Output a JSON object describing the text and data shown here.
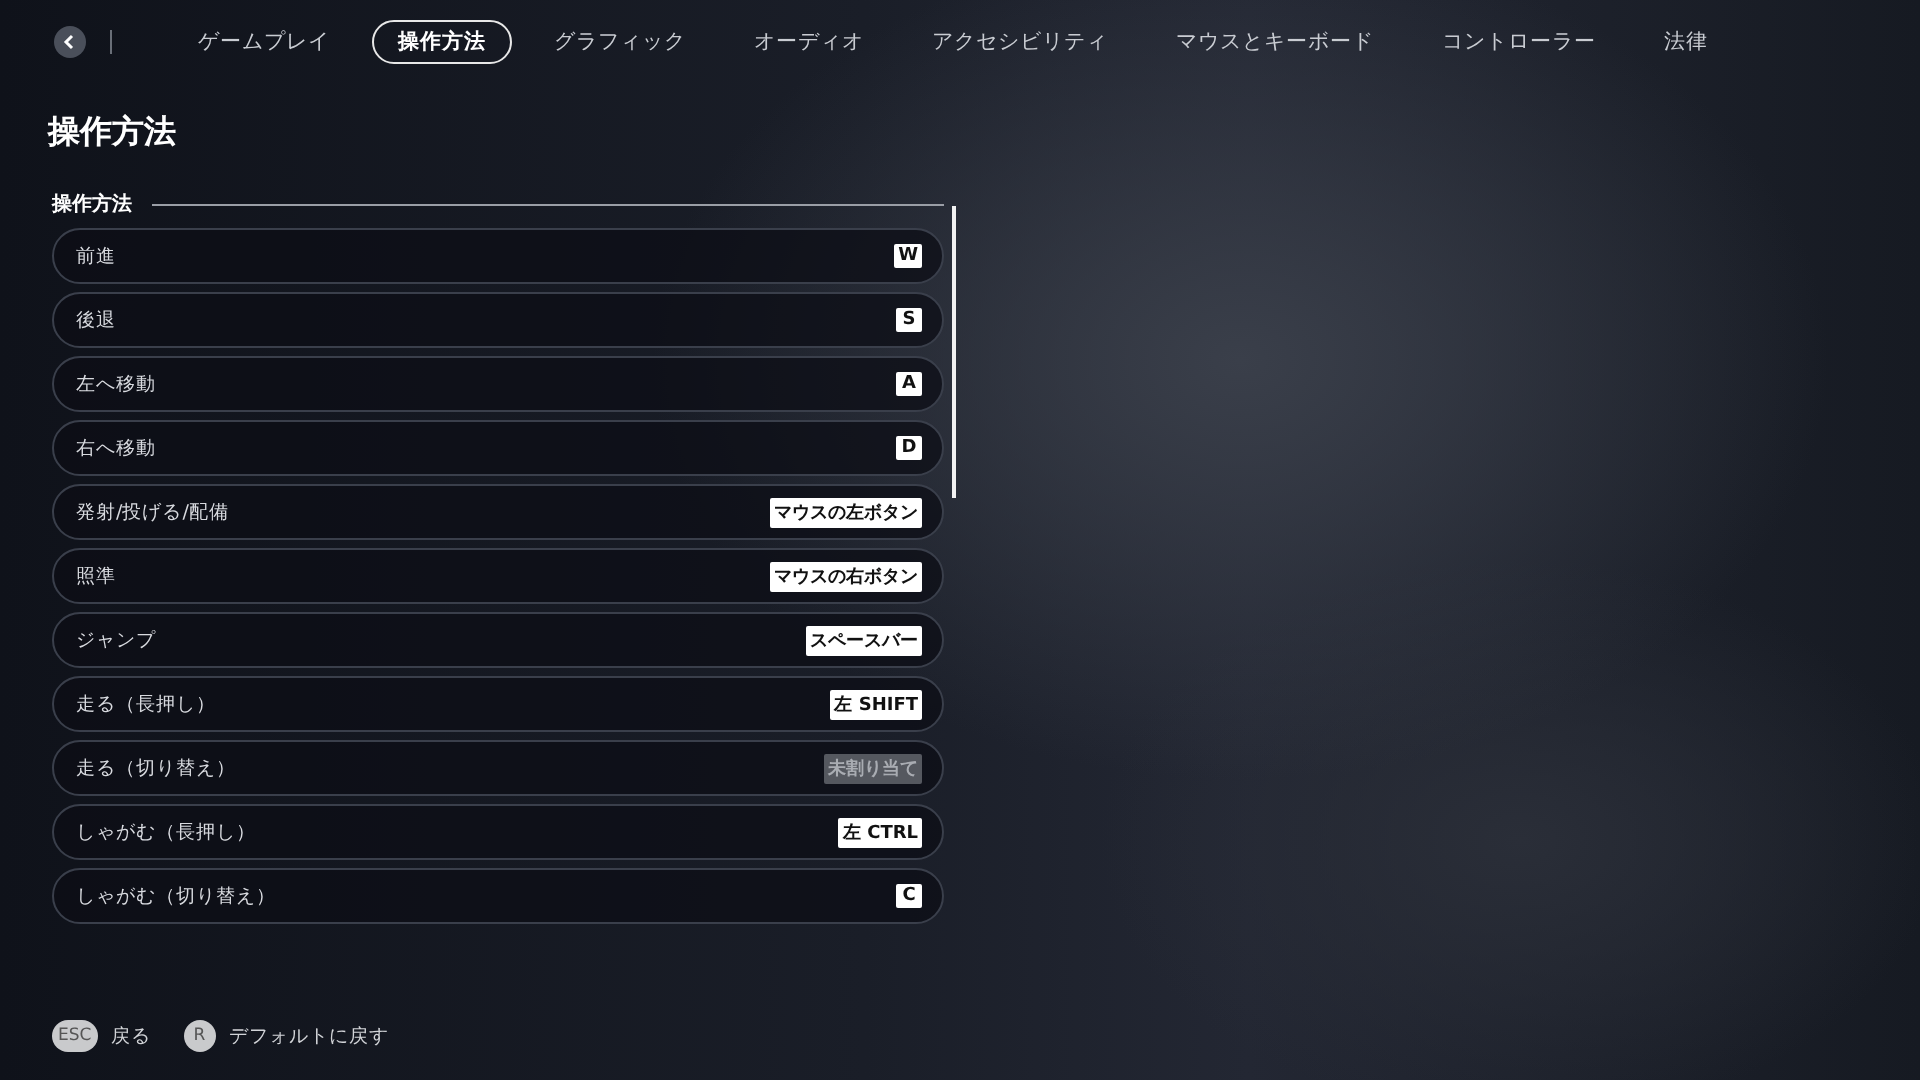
{
  "tabs": [
    {
      "label": "ゲームプレイ",
      "selected": false
    },
    {
      "label": "操作方法",
      "selected": true
    },
    {
      "label": "グラフィック",
      "selected": false
    },
    {
      "label": "オーディオ",
      "selected": false
    },
    {
      "label": "アクセシビリティ",
      "selected": false
    },
    {
      "label": "マウスとキーボード",
      "selected": false
    },
    {
      "label": "コントローラー",
      "selected": false
    },
    {
      "label": "法律",
      "selected": false
    }
  ],
  "page_title": "操作方法",
  "section": {
    "title": "操作方法",
    "bindings": [
      {
        "action": "前進",
        "key": "W",
        "assigned": true
      },
      {
        "action": "後退",
        "key": "S",
        "assigned": true
      },
      {
        "action": "左へ移動",
        "key": "A",
        "assigned": true
      },
      {
        "action": "右へ移動",
        "key": "D",
        "assigned": true
      },
      {
        "action": "発射/投げる/配備",
        "key": "マウスの左ボタン",
        "assigned": true
      },
      {
        "action": "照準",
        "key": "マウスの右ボタン",
        "assigned": true
      },
      {
        "action": "ジャンプ",
        "key": "スペースバー",
        "assigned": true
      },
      {
        "action": "走る（長押し）",
        "key": "左 SHIFT",
        "assigned": true
      },
      {
        "action": "走る（切り替え）",
        "key": "未割り当て",
        "assigned": false
      },
      {
        "action": "しゃがむ（長押し）",
        "key": "左 CTRL",
        "assigned": true
      },
      {
        "action": "しゃがむ（切り替え）",
        "key": "C",
        "assigned": true
      }
    ]
  },
  "footer": [
    {
      "key": "ESC",
      "label": "戻る"
    },
    {
      "key": "R",
      "label": "デフォルトに戻す"
    }
  ]
}
